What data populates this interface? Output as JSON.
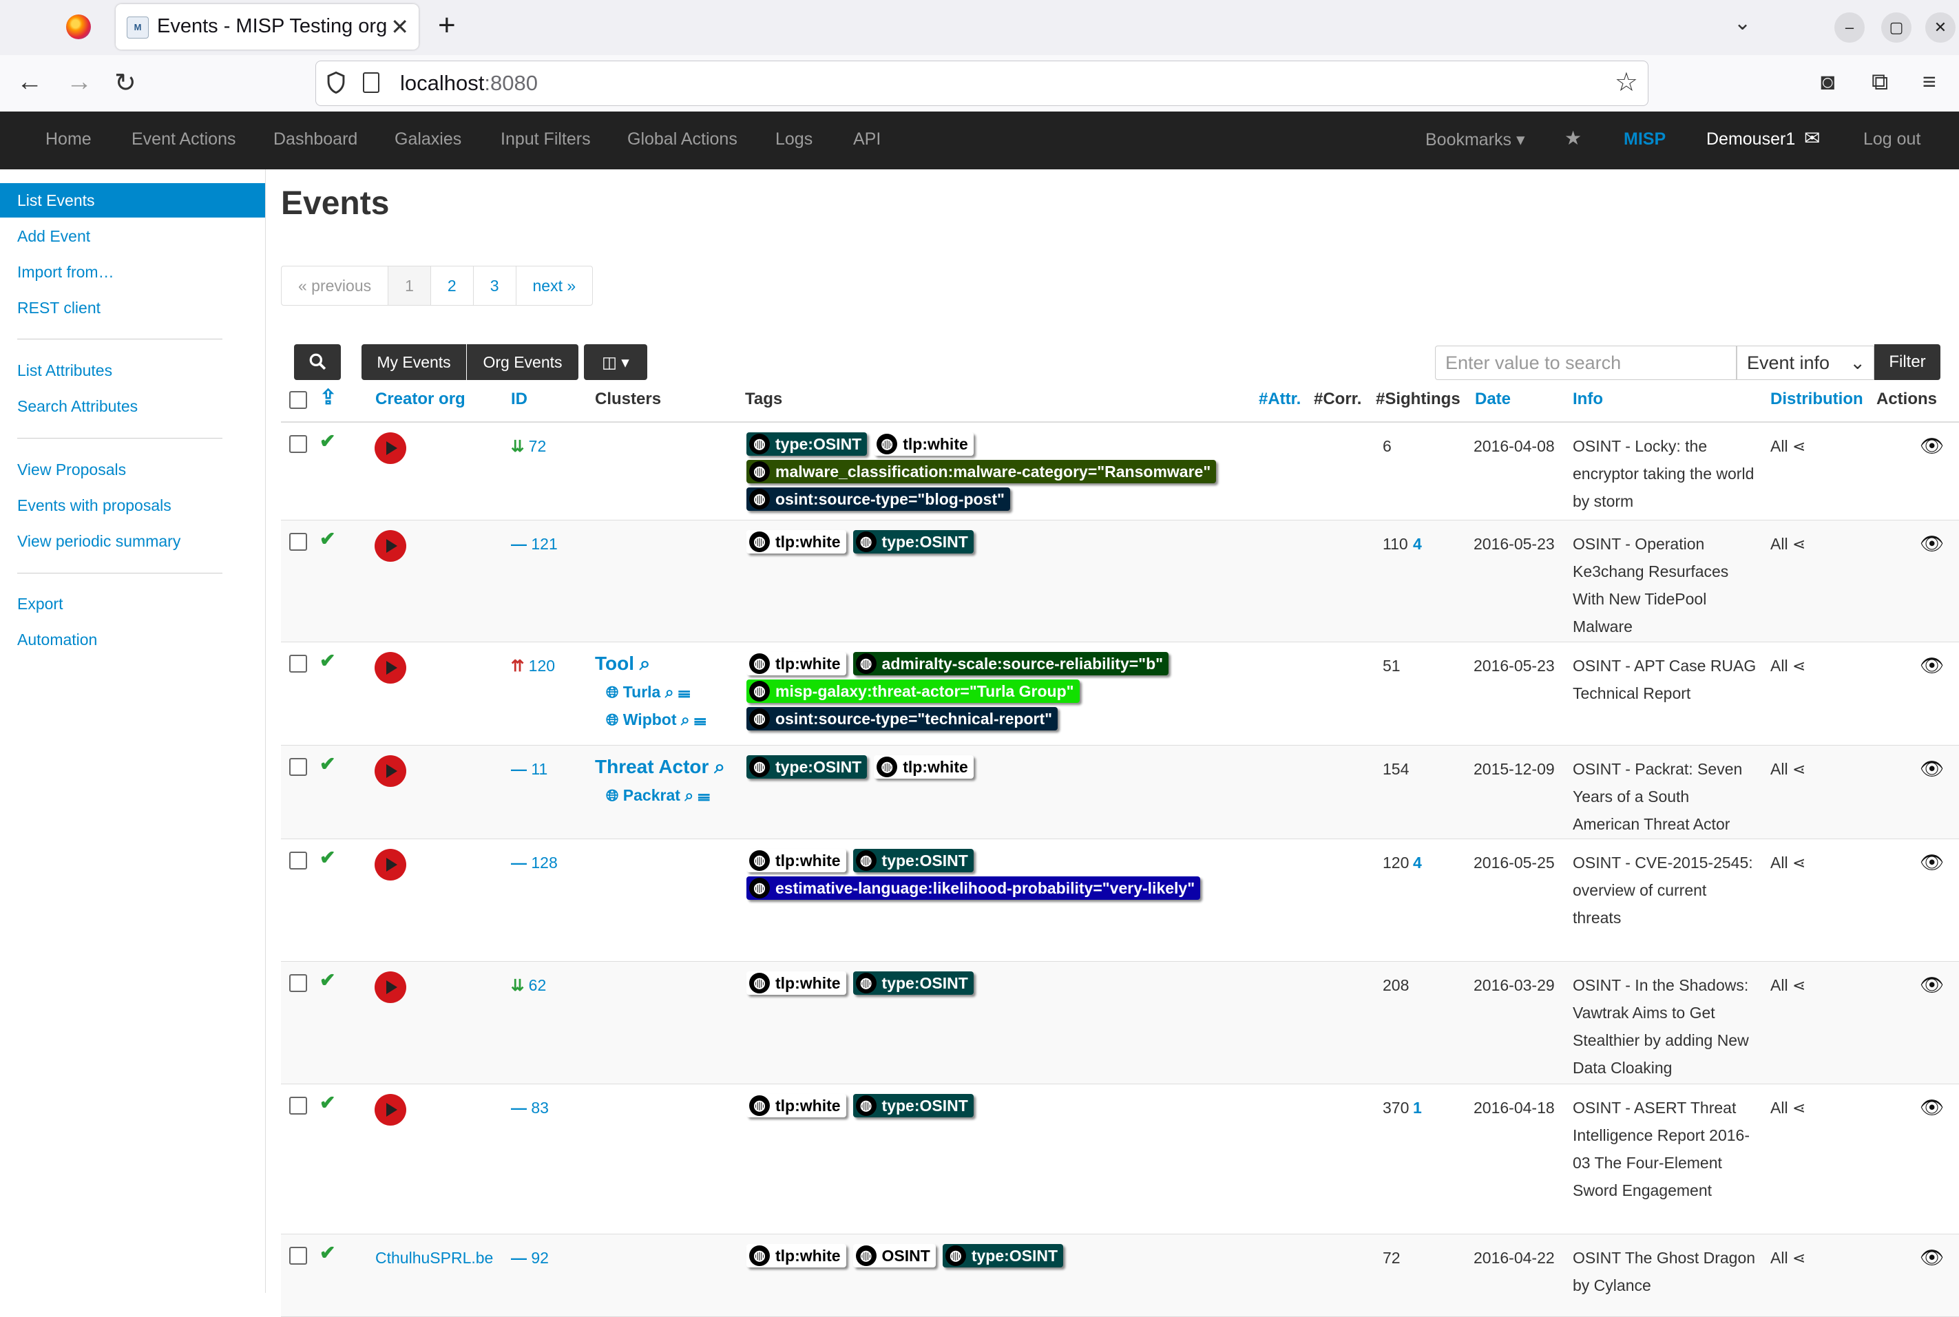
{
  "browser": {
    "tab_title": "Events - MISP Testing org",
    "tab_close": "✕",
    "new_tab": "+",
    "url_host": "localhost",
    "url_port": ":8080"
  },
  "nav": {
    "home": "Home",
    "event_actions": "Event Actions",
    "dashboard": "Dashboard",
    "galaxies": "Galaxies",
    "input_filters": "Input Filters",
    "global_actions": "Global Actions",
    "logs": "Logs",
    "api": "API",
    "bookmarks": "Bookmarks ▾",
    "brand": "MISP",
    "user": "Demouser1",
    "logout": "Log out"
  },
  "sidebar": {
    "items": [
      {
        "label": "List Events"
      },
      {
        "label": "Add Event"
      },
      {
        "label": "Import from…"
      },
      {
        "label": "REST client"
      },
      {
        "label": "List Attributes"
      },
      {
        "label": "Search Attributes"
      },
      {
        "label": "View Proposals"
      },
      {
        "label": "Events with proposals"
      },
      {
        "label": "View periodic summary"
      },
      {
        "label": "Export"
      },
      {
        "label": "Automation"
      }
    ]
  },
  "page_title": "Events",
  "pagination": {
    "prev": "« previous",
    "pages": [
      "1",
      "2",
      "3"
    ],
    "next": "next »"
  },
  "toolbar": {
    "my_events": "My Events",
    "org_events": "Org Events",
    "search_placeholder": "Enter value to search",
    "search_field": "Event info",
    "filter": "Filter"
  },
  "table": {
    "headers": {
      "creator_org": "Creator org",
      "id": "ID",
      "clusters": "Clusters",
      "tags": "Tags",
      "attr": "#Attr.",
      "corr": "#Corr.",
      "sightings": "#Sightings",
      "date": "Date",
      "info": "Info",
      "distribution": "Distribution",
      "actions": "Actions"
    },
    "rows": [
      {
        "id": "72",
        "threat": "⇊",
        "attr": "6",
        "corr": "",
        "date": "2016-04-08",
        "info": "OSINT - Locky: the encryptor taking the world by storm",
        "dist": "All",
        "tags": [
          {
            "text": "type:OSINT",
            "bg": "#004646"
          },
          {
            "text": "tlp:white",
            "bg": "#ffffff"
          },
          {
            "text": "malware_classification:malware-category=\"Ransomware\"",
            "bg": "#2c4f00"
          },
          {
            "text": "osint:source-type=\"blog-post\"",
            "bg": "#00223b"
          }
        ]
      },
      {
        "id": "121",
        "threat": "—",
        "attr": "110",
        "corr": "4",
        "date": "2016-05-23",
        "info": "OSINT - Operation Ke3chang Resurfaces With New TidePool Malware",
        "dist": "All",
        "tags": [
          {
            "text": "tlp:white",
            "bg": "#ffffff"
          },
          {
            "text": "type:OSINT",
            "bg": "#004646"
          }
        ]
      },
      {
        "id": "120",
        "threat": "⇈",
        "attr": "51",
        "corr": "",
        "date": "2016-05-23",
        "info": "OSINT - APT Case RUAG Technical Report",
        "dist": "All",
        "cluster_title": "Tool",
        "clusters": [
          "Turla",
          "Wipbot"
        ],
        "tags": [
          {
            "text": "tlp:white",
            "bg": "#ffffff"
          },
          {
            "text": "admiralty-scale:source-reliability=\"b\"",
            "bg": "#00470a"
          },
          {
            "text": "misp-galaxy:threat-actor=\"Turla Group\"",
            "bg": "#12e000"
          },
          {
            "text": "osint:source-type=\"technical-report\"",
            "bg": "#00223b"
          }
        ]
      },
      {
        "id": "11",
        "threat": "—",
        "attr": "154",
        "corr": "",
        "date": "2015-12-09",
        "info": "OSINT - Packrat: Seven Years of a South American Threat Actor",
        "dist": "All",
        "cluster_title": "Threat Actor",
        "clusters": [
          "Packrat"
        ],
        "tags": [
          {
            "text": "type:OSINT",
            "bg": "#004646"
          },
          {
            "text": "tlp:white",
            "bg": "#ffffff"
          }
        ]
      },
      {
        "id": "128",
        "threat": "—",
        "attr": "120",
        "corr": "4",
        "date": "2016-05-25",
        "info": "OSINT - CVE-2015-2545: overview of current threats",
        "dist": "All",
        "tags": [
          {
            "text": "tlp:white",
            "bg": "#ffffff"
          },
          {
            "text": "type:OSINT",
            "bg": "#004646"
          },
          {
            "text": "estimative-language:likelihood-probability=\"very-likely\"",
            "bg": "#0a00a8"
          }
        ]
      },
      {
        "id": "62",
        "threat": "⇊",
        "attr": "208",
        "corr": "",
        "date": "2016-03-29",
        "info": "OSINT - In the Shadows: Vawtrak Aims to Get Stealthier by adding New Data Cloaking",
        "dist": "All",
        "tags": [
          {
            "text": "tlp:white",
            "bg": "#ffffff"
          },
          {
            "text": "type:OSINT",
            "bg": "#004646"
          }
        ]
      },
      {
        "id": "83",
        "threat": "—",
        "attr": "370",
        "corr": "1",
        "date": "2016-04-18",
        "info": "OSINT - ASERT Threat Intelligence Report 2016-03 The Four-Element Sword Engagement",
        "dist": "All",
        "tags": [
          {
            "text": "tlp:white",
            "bg": "#ffffff"
          },
          {
            "text": "type:OSINT",
            "bg": "#004646"
          }
        ]
      },
      {
        "id": "92",
        "threat": "—",
        "attr": "72",
        "corr": "",
        "date": "2016-04-22",
        "info": "OSINT The Ghost Dragon by Cylance",
        "dist": "All",
        "org_text": "CthulhuSPRL.be",
        "tags": [
          {
            "text": "tlp:white",
            "bg": "#ffffff"
          },
          {
            "text": "OSINT",
            "bg": "#ffffff"
          },
          {
            "text": "type:OSINT",
            "bg": "#004646"
          }
        ]
      }
    ]
  }
}
